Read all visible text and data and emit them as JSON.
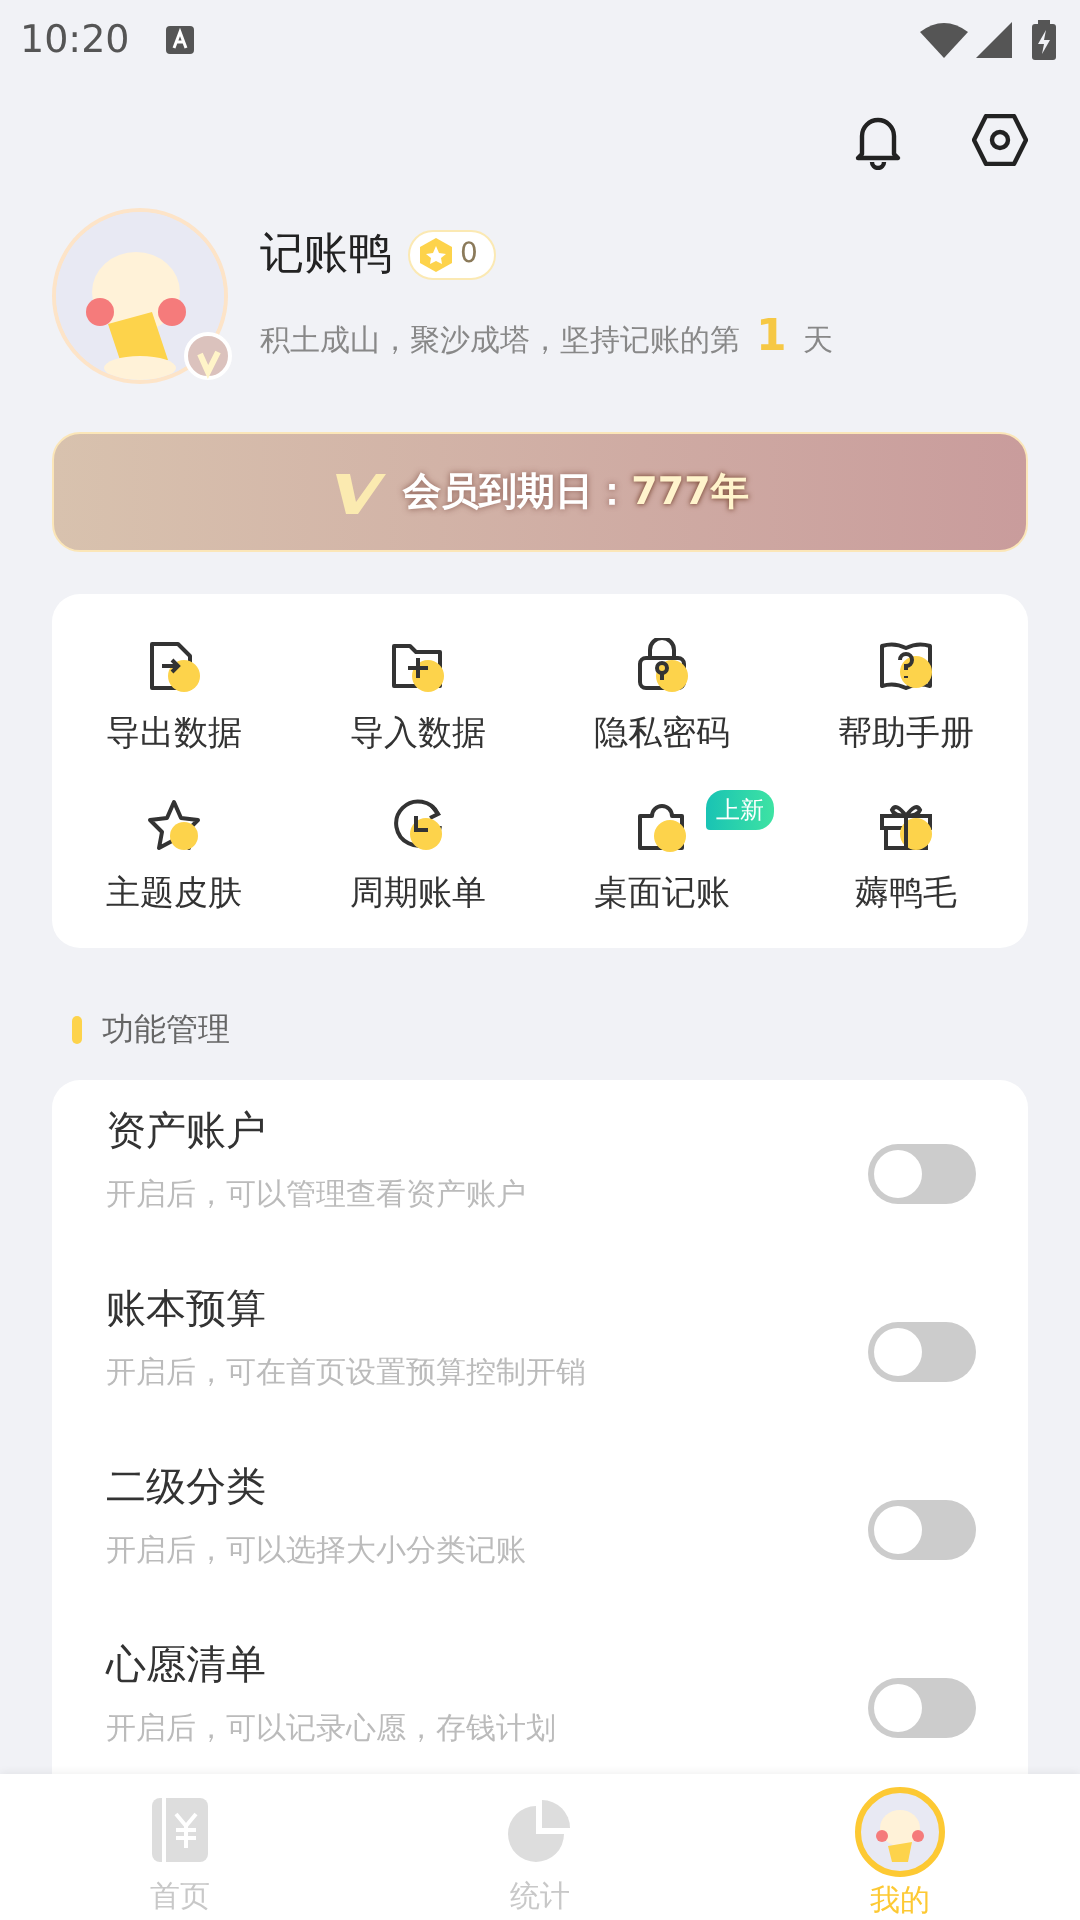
{
  "status_bar": {
    "time": "10:20"
  },
  "profile": {
    "name": "记账鸭",
    "coins": "0",
    "motto_before": "积土成山，聚沙成塔，坚持记账的第",
    "days": "1",
    "motto_after": "天",
    "vip": true
  },
  "membership": {
    "label": "会员到期日：",
    "value": "777年"
  },
  "tools": [
    {
      "label": "导出数据",
      "kind": "export"
    },
    {
      "label": "导入数据",
      "kind": "import"
    },
    {
      "label": "隐私密码",
      "kind": "lock"
    },
    {
      "label": "帮助手册",
      "kind": "help"
    },
    {
      "label": "主题皮肤",
      "kind": "star"
    },
    {
      "label": "周期账单",
      "kind": "clock"
    },
    {
      "label": "桌面记账",
      "kind": "widget",
      "badge": "上新"
    },
    {
      "label": "薅鸭毛",
      "kind": "gift"
    }
  ],
  "section_title": "功能管理",
  "features": [
    {
      "title": "资产账户",
      "description": "开启后，可以管理查看资产账户",
      "on": false
    },
    {
      "title": "账本预算",
      "description": "开启后，可在首页设置预算控制开销",
      "on": false
    },
    {
      "title": "二级分类",
      "description": "开启后，可以选择大小分类记账",
      "on": false
    },
    {
      "title": "心愿清单",
      "description": "开启后，可以记录心愿，存钱计划",
      "on": false
    }
  ],
  "tab_bar": [
    {
      "label": "首页",
      "kind": "book",
      "selected": false
    },
    {
      "label": "统计",
      "kind": "pie",
      "selected": false
    },
    {
      "label": "我的",
      "kind": "avatar",
      "selected": true
    }
  ]
}
